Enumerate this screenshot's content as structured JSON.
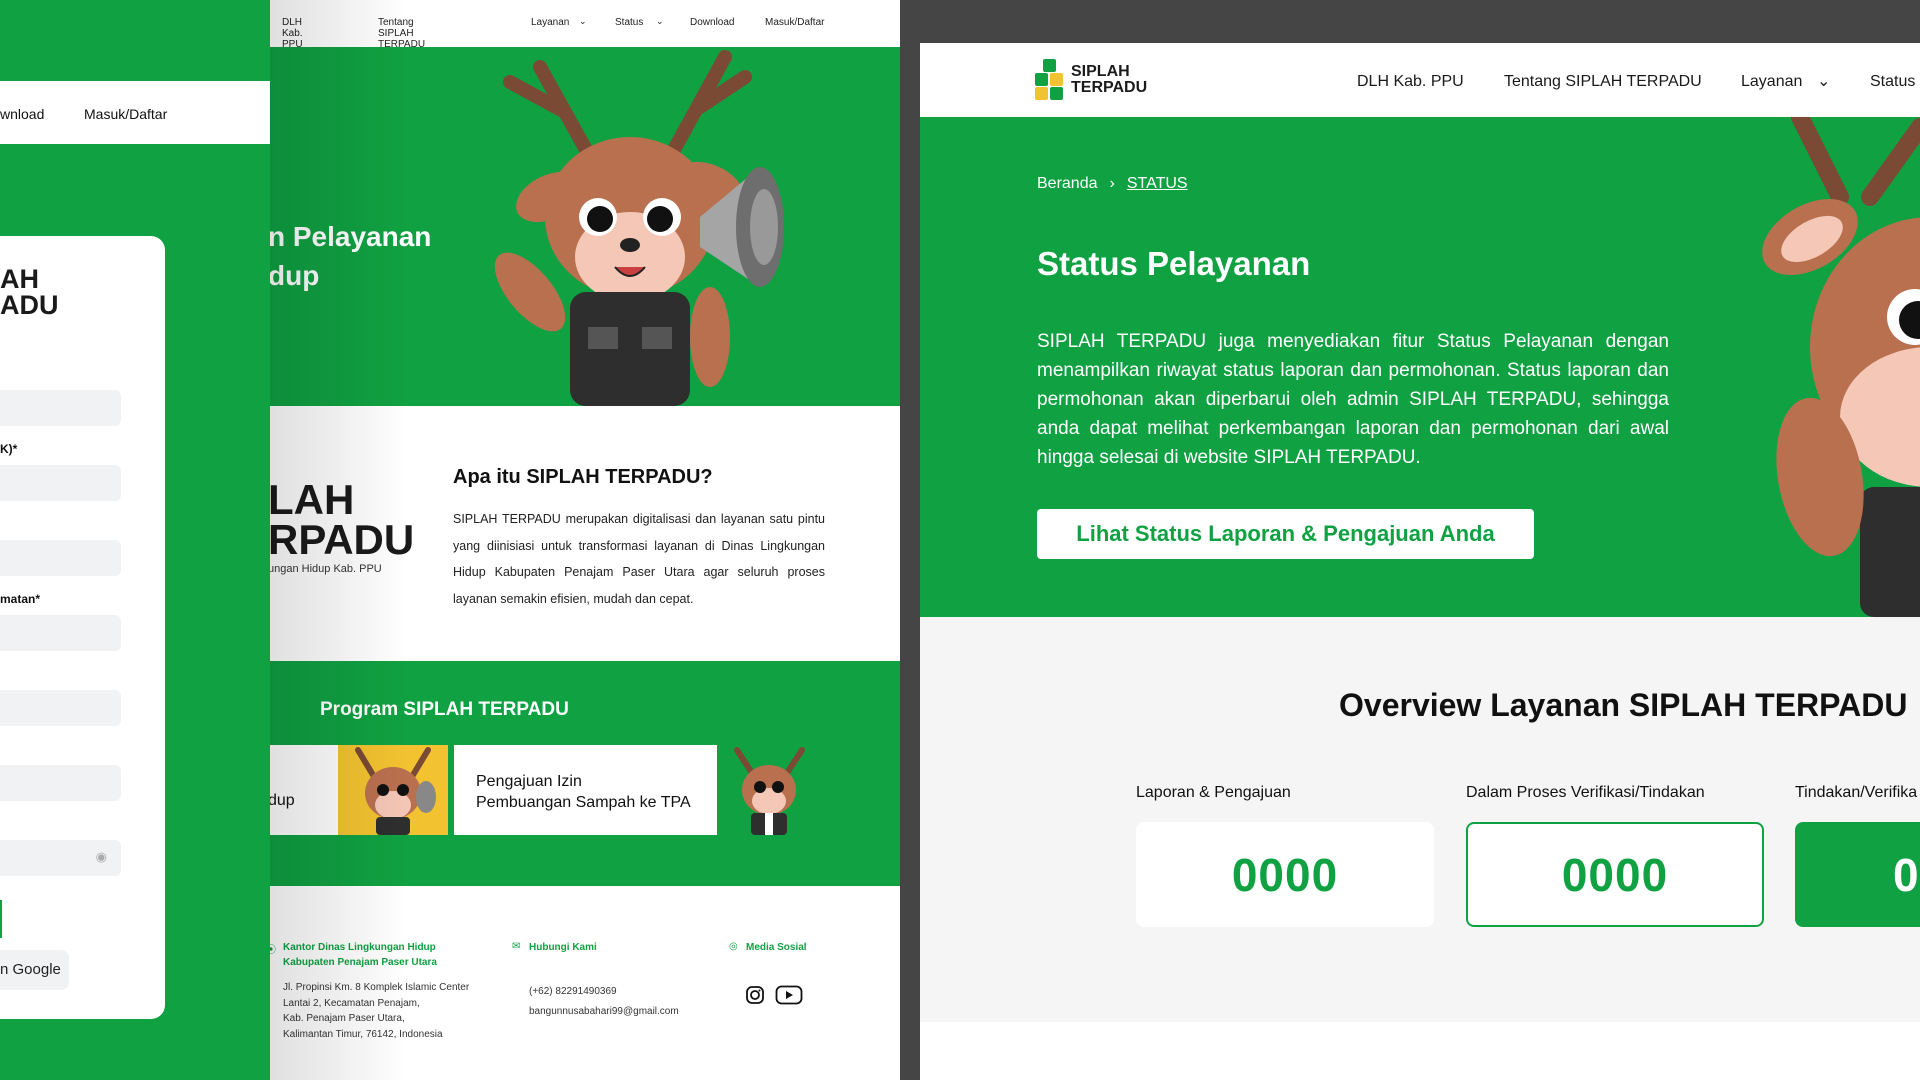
{
  "colors": {
    "brand_green": "#10A142",
    "logo_green": "#10A142",
    "logo_yellow": "#F2C230",
    "mascot_brown": "#B9704F"
  },
  "brand": {
    "line1": "SIPLAH",
    "line2": "TERPADU"
  },
  "left": {
    "nav": [
      "DLH Kab. PPU",
      "Tentang SIPLAH TERPADU",
      "Layanan",
      "Status",
      "Download",
      "Masuk/Daftar"
    ],
    "hero_title_1": "n Pelayanan",
    "hero_title_2": "dup",
    "about": {
      "brand_1": "LAH",
      "brand_2": "RPADU",
      "brand_sub": "ungan Hidup Kab. PPU",
      "title": "Apa itu SIPLAH TERPADU?",
      "text": "SIPLAH TERPADU merupakan digitalisasi dan layanan satu pintu yang diinisiasi untuk transformasi layanan di Dinas Lingkungan Hidup Kabupaten Penajam Paser Utara agar seluruh proses layanan semakin efisien, mudah dan cepat."
    },
    "program": {
      "title": "Program SIPLAH TERPADU",
      "card1": "dup",
      "card2_1": "Pengajuan Izin",
      "card2_2": "Pembuangan Sampah ke TPA"
    },
    "footer": {
      "office_title_1": "Kantor Dinas Lingkungan Hidup",
      "office_title_2": "Kabupaten Penajam Paser Utara",
      "address_1": "Jl. Propinsi Km. 8 Komplek Islamic Center",
      "address_2": "Lantai 2, Kecamatan Penajam,",
      "address_3": "Kab. Penajam Paser Utara,",
      "address_4": "Kalimantan Timur, 76142, Indonesia",
      "contact_title": "Hubungi Kami",
      "phone": "(+62) 82291490369",
      "email": "bangunnusabahari99@gmail.com",
      "social_title": "Media Sosial"
    },
    "overlay": {
      "nav_download": "wnload",
      "nav_login": "Masuk/Daftar",
      "brand_1": "AH",
      "brand_2": "ADU",
      "label_1": "K)*",
      "label_2": "matan*",
      "google": "n Google"
    }
  },
  "right": {
    "nav": [
      "DLH Kab. PPU",
      "Tentang SIPLAH TERPADU",
      "Layanan",
      "Status"
    ],
    "breadcrumb": {
      "home": "Beranda",
      "current": "STATUS"
    },
    "title": "Status Pelayanan",
    "description": "SIPLAH TERPADU juga menyediakan fitur Status Pelayanan dengan menampilkan riwayat status laporan dan permohonan. Status laporan dan permohonan akan diperbarui oleh admin SIPLAH TERPADU, sehingga anda dapat melihat perkembangan laporan dan permohonan dari awal hingga selesai di website SIPLAH TERPADU.",
    "button": "Lihat Status Laporan & Pengajuan Anda",
    "overview_title": "Overview Layanan SIPLAH TERPADU",
    "stats": [
      {
        "label": "Laporan & Pengajuan",
        "value": "0000"
      },
      {
        "label": "Dalam Proses Verifikasi/Tindakan",
        "value": "0000"
      },
      {
        "label": "Tindakan/Verifika",
        "value": "0"
      }
    ]
  }
}
